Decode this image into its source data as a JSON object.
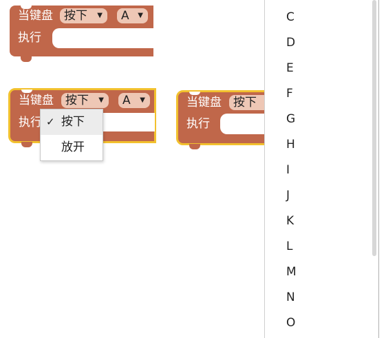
{
  "block1": {
    "label_when": "当键盘",
    "field_action": "按下",
    "field_key": "A",
    "label_do": "执行"
  },
  "block2": {
    "label_when": "当键盘",
    "field_action": "按下",
    "field_key": "A",
    "label_do": "执行"
  },
  "block3": {
    "label_when": "当键盘",
    "field_action": "按下",
    "label_do": "执行"
  },
  "action_menu": {
    "items": [
      {
        "label": "按下",
        "checked": true,
        "check_mark": "✓"
      },
      {
        "label": "放开",
        "checked": false
      }
    ]
  },
  "key_menu": {
    "items": [
      "C",
      "D",
      "E",
      "F",
      "G",
      "H",
      "I",
      "J",
      "K",
      "L",
      "M",
      "N",
      "O"
    ]
  },
  "colors": {
    "block": "#c0674a",
    "field": "#eec7b5",
    "highlight": "#f2c12e"
  }
}
